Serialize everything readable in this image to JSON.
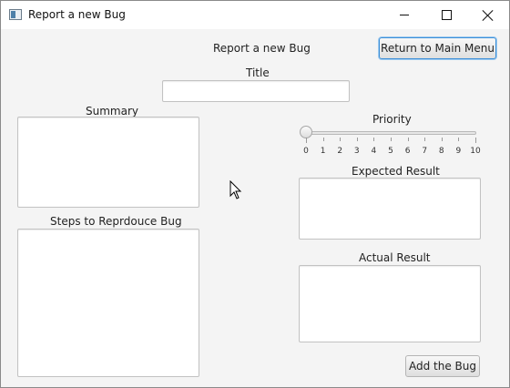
{
  "window": {
    "title": "Report a new Bug",
    "app_icon": "app-window-icon",
    "controls": {
      "minimize": "minimize-icon",
      "maximize": "maximize-icon",
      "close": "close-icon"
    }
  },
  "form": {
    "heading": "Report a new Bug",
    "return_button": "Return to Main Menu",
    "title_label": "Title",
    "title_value": "",
    "summary_label": "Summary",
    "summary_value": "",
    "steps_label": "Steps to Reprdouce Bug",
    "steps_value": "",
    "priority_label": "Priority",
    "priority": {
      "min": 0,
      "max": 10,
      "value": 0,
      "ticks": [
        "0",
        "1",
        "2",
        "3",
        "4",
        "5",
        "6",
        "7",
        "8",
        "9",
        "10"
      ]
    },
    "expected_label": "Expected Result",
    "expected_value": "",
    "actual_label": "Actual Result",
    "actual_value": "",
    "add_button": "Add the Bug"
  },
  "colors": {
    "focus": "#3c8fd8",
    "background": "#f4f4f4"
  }
}
